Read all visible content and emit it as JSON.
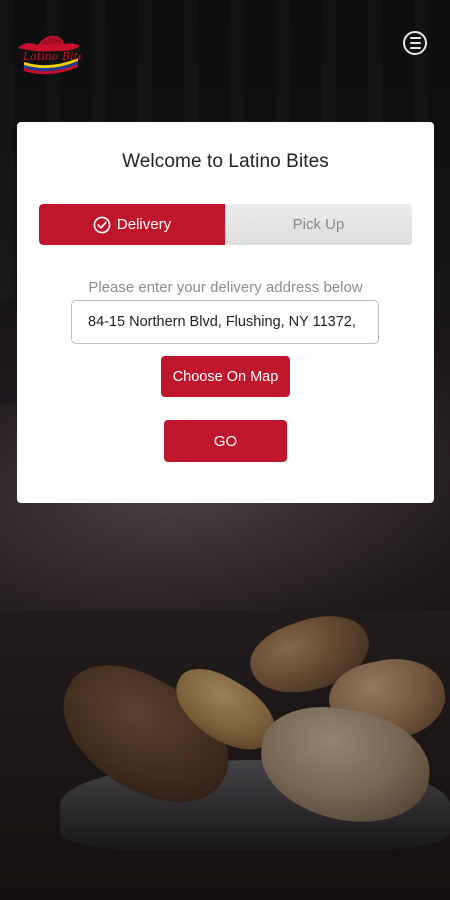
{
  "header": {
    "logo_text": "Latino Bites",
    "menu_icon": "hamburger-menu-icon"
  },
  "card": {
    "title": "Welcome to Latino Bites",
    "tabs": [
      {
        "label": "Delivery",
        "selected": true,
        "icon": "check-circle-icon"
      },
      {
        "label": "Pick Up",
        "selected": false
      }
    ],
    "address_hint": "Please enter your delivery address below",
    "address_value": "84-15 Northern Blvd, Flushing, NY 11372,",
    "choose_map_label": "Choose On Map",
    "go_label": "GO"
  },
  "colors": {
    "accent": "#c0162b",
    "card_bg": "#ffffff",
    "tab_inactive_bg": "#e6e6e6"
  }
}
